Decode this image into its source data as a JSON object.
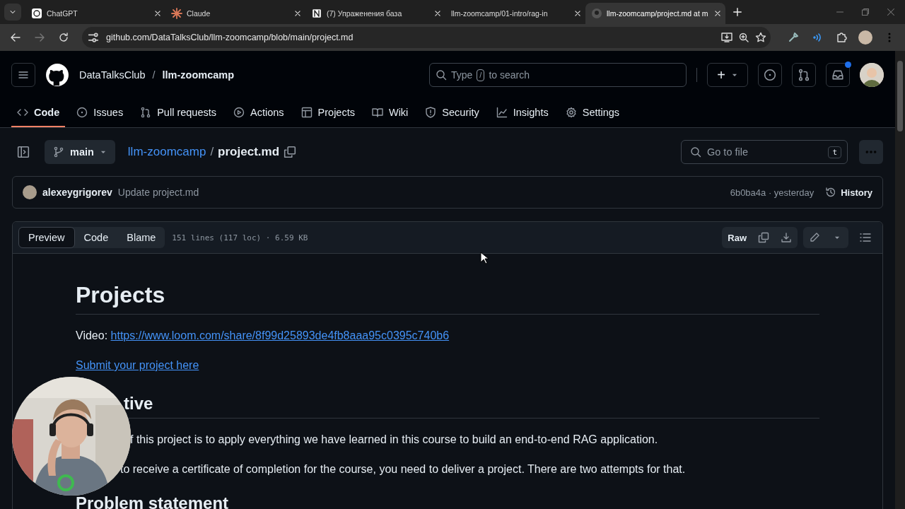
{
  "browser": {
    "tabs": [
      {
        "title": "ChatGPT",
        "selected": false
      },
      {
        "title": "Claude",
        "selected": false
      },
      {
        "title": "(7) Упраженения база",
        "selected": false
      },
      {
        "title": "llm-zoomcamp/01-intro/rag-in",
        "selected": false
      },
      {
        "title": "llm-zoomcamp/project.md at m",
        "selected": true
      }
    ],
    "address": "github.com/DataTalksClub/llm-zoomcamp/blob/main/project.md"
  },
  "header": {
    "owner": "DataTalksClub",
    "separator": "/",
    "repo": "llm-zoomcamp",
    "search": {
      "before": "Type",
      "key": "/",
      "after": "to search"
    },
    "plus": "+"
  },
  "nav": [
    {
      "label": "Code",
      "selected": true
    },
    {
      "label": "Issues",
      "selected": false
    },
    {
      "label": "Pull requests",
      "selected": false
    },
    {
      "label": "Actions",
      "selected": false
    },
    {
      "label": "Projects",
      "selected": false
    },
    {
      "label": "Wiki",
      "selected": false
    },
    {
      "label": "Security",
      "selected": false
    },
    {
      "label": "Insights",
      "selected": false
    },
    {
      "label": "Settings",
      "selected": false
    }
  ],
  "file_header": {
    "branch": "main",
    "repo_link": "llm-zoomcamp",
    "separator": "/",
    "file": "project.md",
    "go_to_file": {
      "placeholder": "Go to file",
      "key": "t"
    }
  },
  "commit": {
    "author": "alexeygrigorev",
    "message": "Update project.md",
    "sha_time": "6b0ba4a · yesterday",
    "history": "History"
  },
  "file_toolbar": {
    "views": [
      {
        "label": "Preview",
        "selected": true
      },
      {
        "label": "Code",
        "selected": false
      },
      {
        "label": "Blame",
        "selected": false
      }
    ],
    "info": "151 lines (117 loc) · 6.59 KB",
    "raw": "Raw"
  },
  "document": [
    {
      "kind": "h1",
      "text": "Projects"
    },
    {
      "kind": "labeled_link",
      "label": "Video:",
      "link": "https://www.loom.com/share/8f99d25893de4fb8aaa95c0395c740b6"
    },
    {
      "kind": "link",
      "text": "Submit your project here"
    },
    {
      "kind": "h2",
      "text": "tive"
    },
    {
      "kind": "p",
      "text": "f this project is to apply everything we have learned in this course to build an end-to-end RAG application."
    },
    {
      "kind": "p",
      "text": "to receive a certificate of completion for the course, you need to deliver a project. There are two attempts for that."
    },
    {
      "kind": "h2",
      "text": "Problem statement"
    }
  ]
}
